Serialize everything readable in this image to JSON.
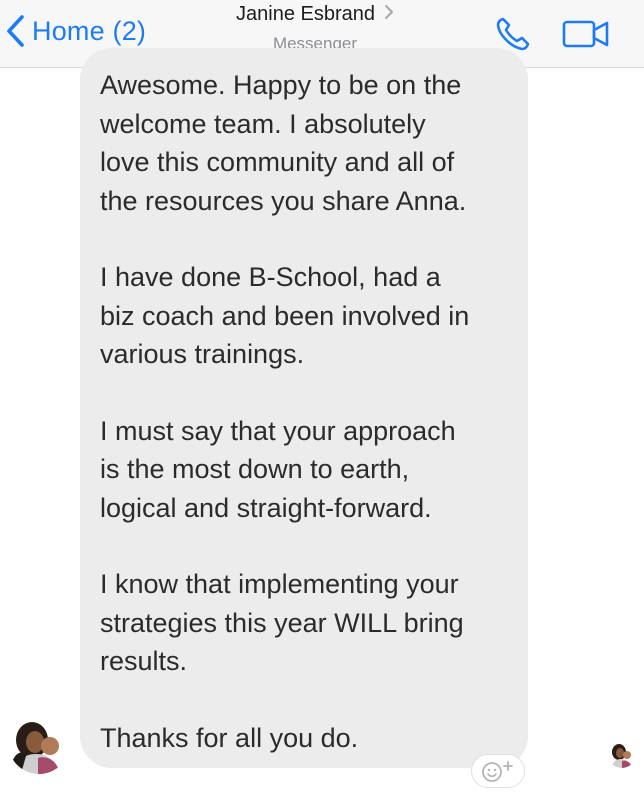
{
  "header": {
    "back_label": "Home (2)",
    "contact_name": "Janine Esbrand",
    "subtitle": "Messenger",
    "accent_color": "#1d7cf2",
    "back_icon": "chevron-left-icon",
    "title_icon": "chevron-right-icon",
    "call_icon": "phone-icon",
    "video_icon": "video-camera-icon"
  },
  "message": {
    "bubble_color": "#ececed",
    "paragraphs": [
      "Awesome. Happy to be on the\nwelcome team. I absolutely\nlove this community and all of\nthe resources you share Anna.",
      "I have done B-School, had a\nbiz coach and been involved in\nvarious trainings.",
      "I must say that your approach\nis the most down to earth,\nlogical and straight-forward.",
      "I know that implementing your\nstrategies this year WILL bring\nresults.",
      "Thanks for all you do."
    ]
  },
  "reaction": {
    "icon": "add-reaction-icon"
  }
}
